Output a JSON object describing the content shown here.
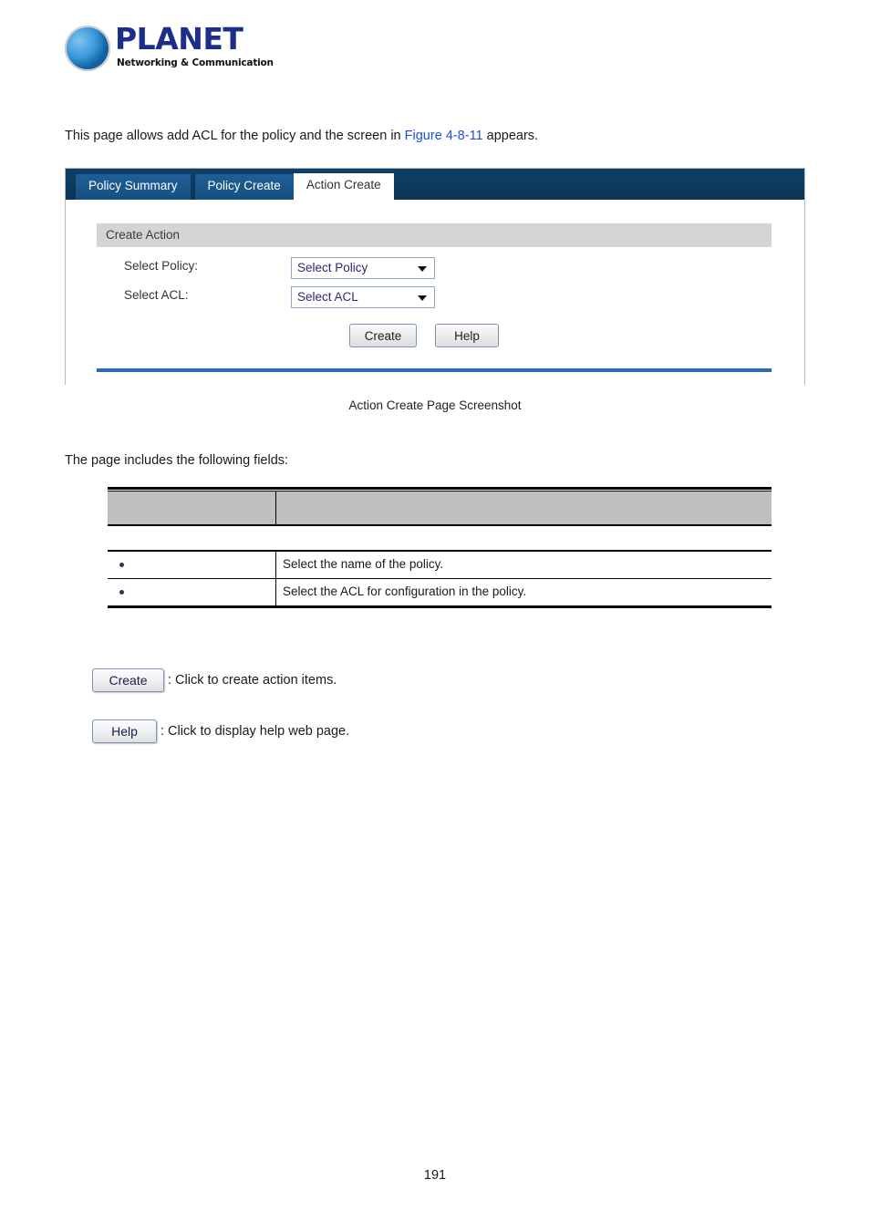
{
  "header": {
    "logo_word": "PLANET",
    "logo_tagline": "Networking & Communication",
    "logo_icon": "planet-globe-logo"
  },
  "intro": {
    "text_before": "This page allows add ACL for the policy and the screen in ",
    "figure_link": "Figure 4-8-11",
    "text_after": " appears."
  },
  "screenshot": {
    "tabs": [
      {
        "label": "Policy Summary",
        "active": false
      },
      {
        "label": "Policy Create",
        "active": false
      },
      {
        "label": "Action Create",
        "active": true
      }
    ],
    "section_title": "Create Action",
    "fields": [
      {
        "label": "Select Policy:",
        "value": "Select Policy"
      },
      {
        "label": "Select ACL:",
        "value": "Select ACL"
      }
    ],
    "buttons": {
      "create": "Create",
      "help": "Help"
    },
    "accent_color": "#2a6cad",
    "header_color": "#0c3a60"
  },
  "caption": "Action Create Page Screenshot",
  "fields_intro": "The page includes the following fields:",
  "field_table": {
    "headers": [
      "",
      ""
    ],
    "rows": [
      {
        "object": "",
        "description": "Select the name of the policy."
      },
      {
        "object": "",
        "description": "Select the ACL for configuration in the policy."
      }
    ]
  },
  "button_legend": [
    {
      "button": "Create",
      "description": ": Click to create action items."
    },
    {
      "button": "Help",
      "description": ": Click to display help web page."
    }
  ],
  "page_number": "191"
}
